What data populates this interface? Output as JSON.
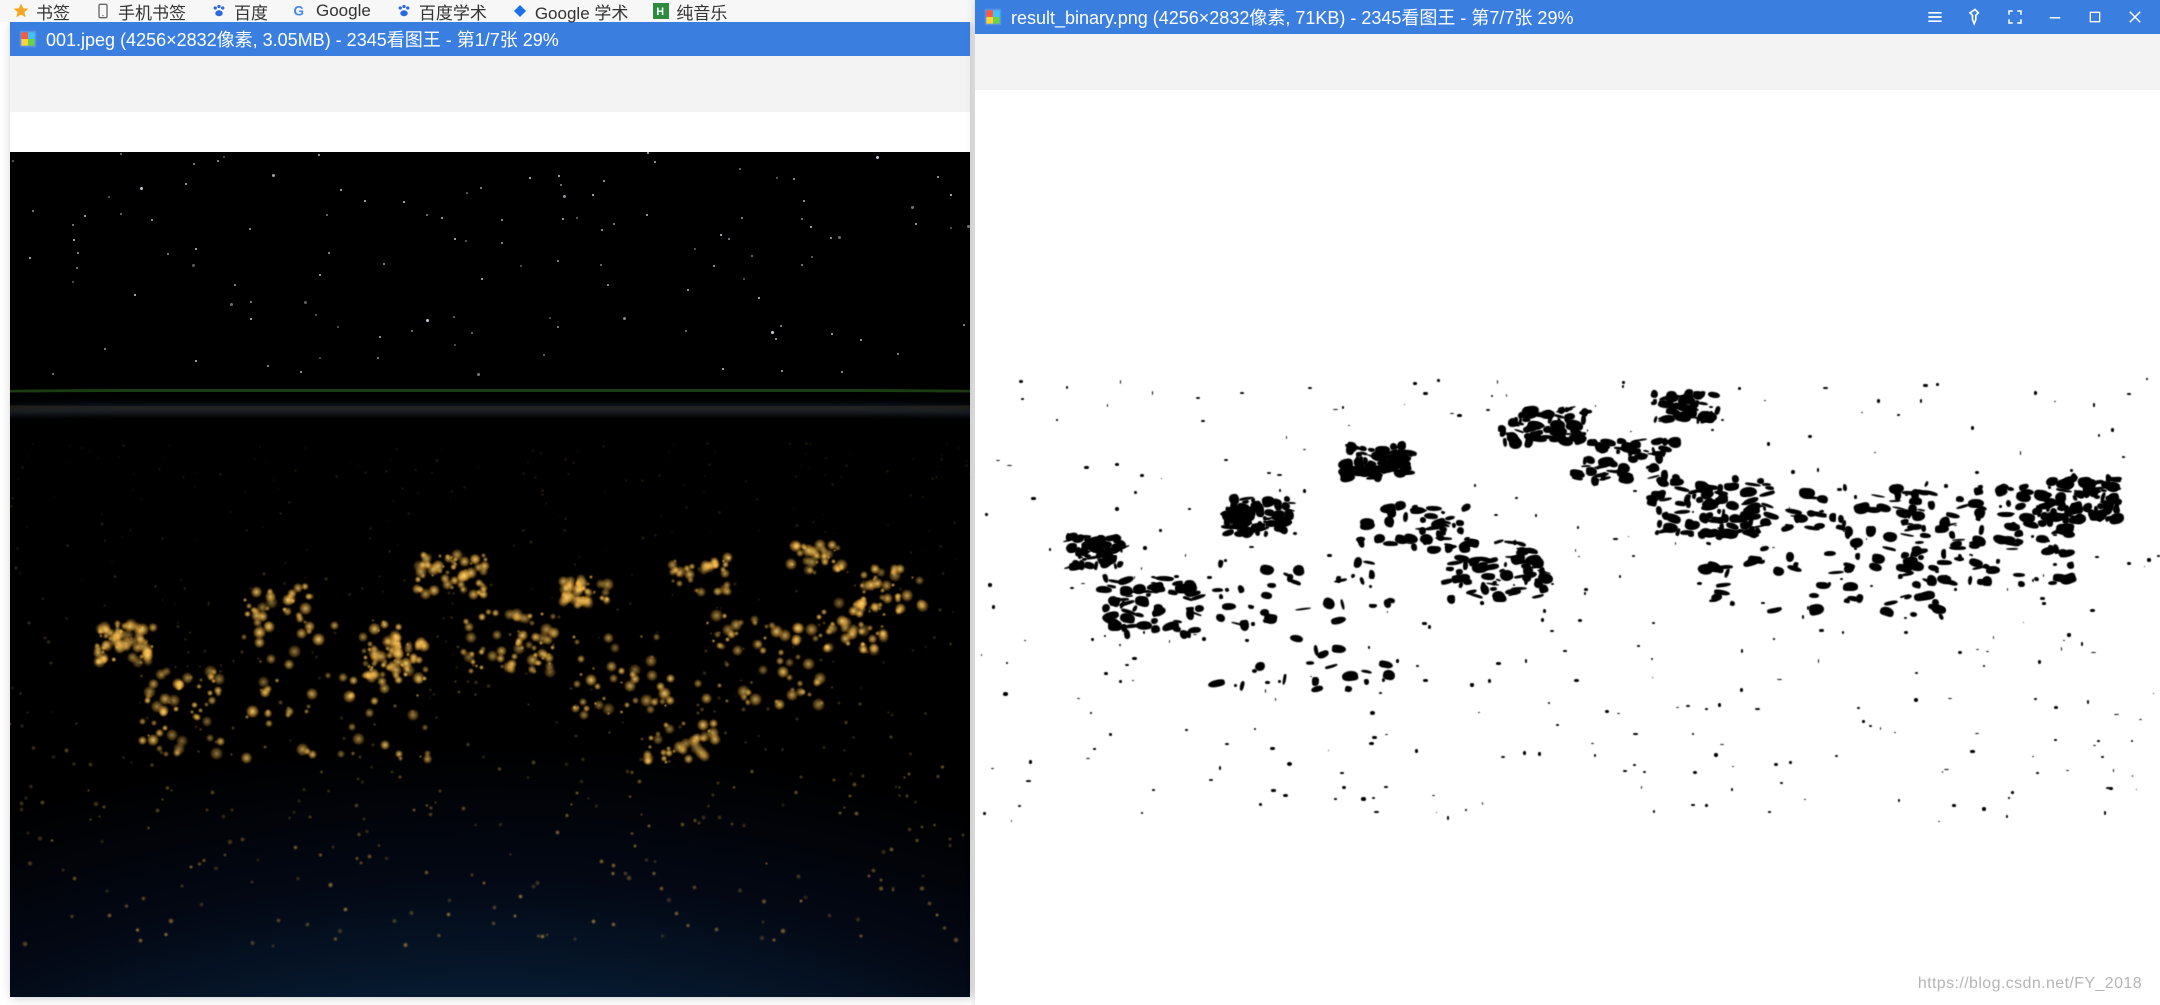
{
  "bookmarks": {
    "items": [
      {
        "label": "书签",
        "icon": "star-icon",
        "icon_color": "#f6a623"
      },
      {
        "label": "手机书签",
        "icon": "phone-icon",
        "icon_color": "#666"
      },
      {
        "label": "百度",
        "icon": "paw-icon",
        "icon_color": "#2a6ae0"
      },
      {
        "label": "Google",
        "icon": "google-icon",
        "icon_color": "#4285f4"
      },
      {
        "label": "百度学术",
        "icon": "paw-icon",
        "icon_color": "#2a6ae0"
      },
      {
        "label": "Google 学术",
        "icon": "diamond-icon",
        "icon_color": "#1a73e8"
      },
      {
        "label": "纯音乐",
        "icon": "square-h-icon",
        "icon_color": "#2e8b3d"
      }
    ]
  },
  "window_left": {
    "title": "001.jpeg  (4256×2832像素, 3.05MB)  - 2345看图王 - 第1/7张 29%"
  },
  "window_right": {
    "title": "result_binary.png  (4256×2832像素, 71KB)  - 2345看图王 - 第7/7张 29%"
  },
  "watermark": "https://blog.csdn.net/FY_2018"
}
